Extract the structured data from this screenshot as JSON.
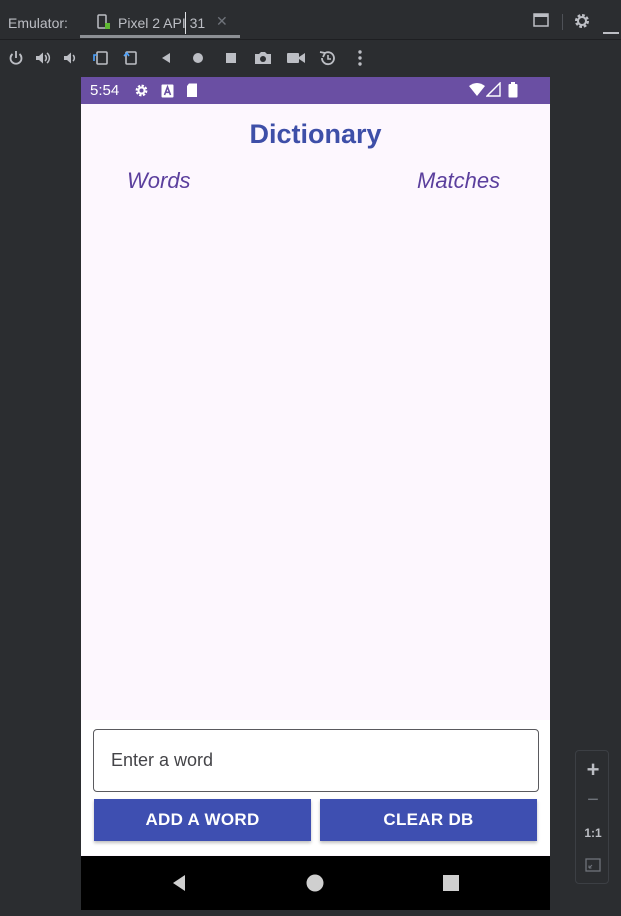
{
  "ide": {
    "emulator_label": "Emulator:",
    "tab_title": "Pixel 2 API 31",
    "tab_close": "✕"
  },
  "toolbar": {
    "icons": [
      "power-icon",
      "volume-up-icon",
      "volume-down-icon",
      "rotate-left-icon",
      "rotate-right-icon",
      "back-icon",
      "home-icon",
      "overview-icon",
      "camera-icon",
      "video-icon",
      "snapshot-icon",
      "more-icon"
    ]
  },
  "device": {
    "status_time": "5:54"
  },
  "app": {
    "title": "Dictionary",
    "col_words": "Words",
    "col_matches": "Matches",
    "input_placeholder": "Enter a word",
    "input_value": "",
    "add_button": "ADD A WORD",
    "clear_button": "CLEAR DB"
  },
  "zoom": {
    "plus": "+",
    "minus": "−",
    "one_to_one": "1:1"
  },
  "colors": {
    "status_bar": "#6a4fa3",
    "title": "#3e4fa8",
    "column_header": "#5b3f9d",
    "button": "#3e4fb1",
    "app_bg": "#fdf7fe"
  }
}
